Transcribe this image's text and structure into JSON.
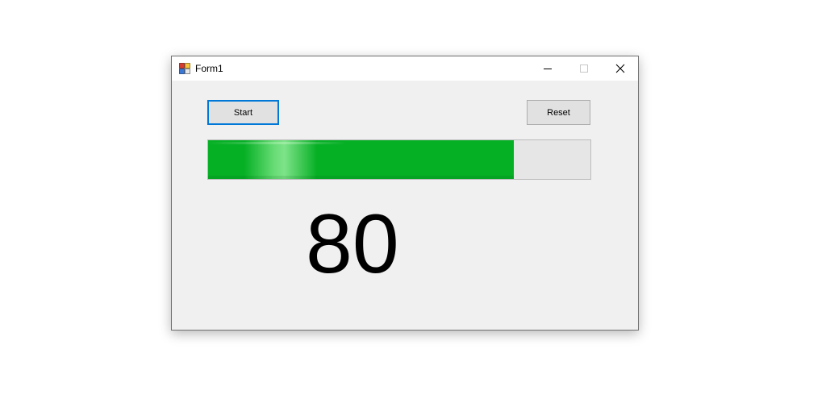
{
  "window": {
    "title": "Form1",
    "icon": "winforms-app-icon",
    "controls": {
      "minimize_icon": "minimize-icon",
      "maximize_icon": "maximize-icon",
      "close_icon": "close-icon"
    }
  },
  "buttons": {
    "start_label": "Start",
    "reset_label": "Reset"
  },
  "progress": {
    "value": 80,
    "max": 100,
    "fill_color": "#06b025",
    "track_color": "#e6e6e6"
  },
  "display": {
    "value_text": "80"
  },
  "colors": {
    "focus_border": "#0078d7",
    "window_bg": "#f0f0f0"
  }
}
